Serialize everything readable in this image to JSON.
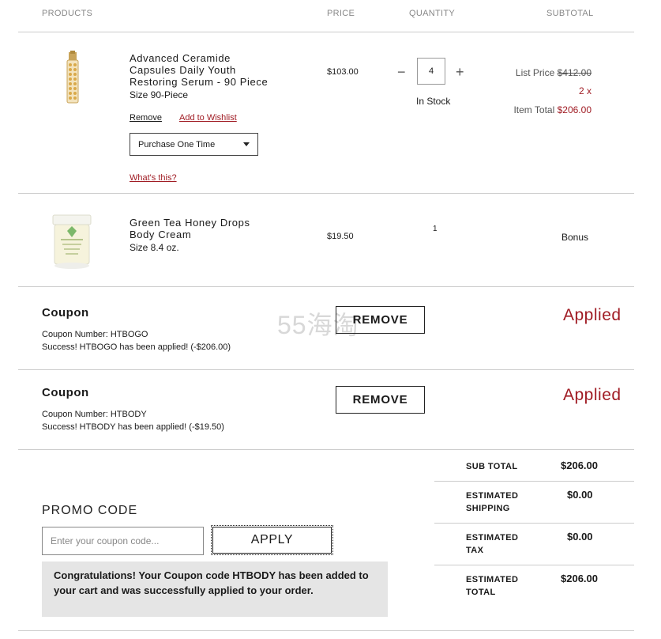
{
  "header": {
    "products": "PRODUCTS",
    "price": "PRICE",
    "quantity": "QUANTITY",
    "subtotal": "SUBTOTAL"
  },
  "items": [
    {
      "name_line1": "Advanced Ceramide",
      "name_line2": "Capsules Daily Youth",
      "name_line3": "Restoring Serum - 90 Piece",
      "size": "Size 90-Piece",
      "price": "$103.00",
      "quantity": "4",
      "stock": "In Stock",
      "remove_label": "Remove",
      "wishlist_label": "Add to Wishlist",
      "purchase_option": "Purchase One Time",
      "whats_this": "What's this?",
      "list_price_label": "List Price",
      "list_price": "$412.00",
      "multiplier": "2 x",
      "item_total_label": "Item Total",
      "item_total": "$206.00",
      "image_icon": "serum-bottle-image"
    },
    {
      "name_line1": "Green Tea Honey Drops",
      "name_line2": "Body Cream",
      "size": "Size 8.4 oz.",
      "price": "$19.50",
      "quantity": "1",
      "subtotal": "Bonus",
      "image_icon": "cream-jar-image"
    }
  ],
  "coupons": [
    {
      "title": "Coupon",
      "number": "Coupon Number: HTBOGO",
      "message": "Success! HTBOGO has been applied! (-$206.00)",
      "remove_label": "REMOVE",
      "status": "Applied"
    },
    {
      "title": "Coupon",
      "number": "Coupon Number: HTBODY",
      "message": "Success! HTBODY has been applied! (-$19.50)",
      "remove_label": "REMOVE",
      "status": "Applied"
    }
  ],
  "watermark": "55海淘",
  "promo": {
    "title": "PROMO CODE",
    "placeholder": "Enter your coupon code...",
    "apply_label": "APPLY",
    "message": "Congratulations! Your Coupon code HTBODY has been added to your cart and was successfully applied to your order."
  },
  "totals": {
    "subtotal_label": "SUB TOTAL",
    "subtotal": "$206.00",
    "shipping_label_1": "ESTIMATED",
    "shipping_label_2": "SHIPPING",
    "shipping": "$0.00",
    "tax_label_1": "ESTIMATED",
    "tax_label_2": "TAX",
    "tax": "$0.00",
    "total_label_1": "ESTIMATED",
    "total_label_2": "TOTAL",
    "total": "$206.00"
  },
  "colors": {
    "accent_red": "#a01c24",
    "divider": "#cccccc",
    "message_bg": "#e5e5e5"
  }
}
